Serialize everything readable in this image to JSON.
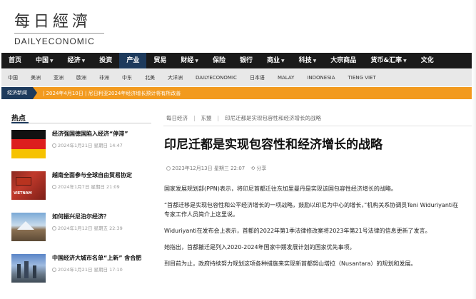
{
  "logo": {
    "zh": "每日經濟",
    "en": "DAILYECONOMIC"
  },
  "main_nav": [
    {
      "label": "首页",
      "caret": false
    },
    {
      "label": "中国",
      "caret": true
    },
    {
      "label": "经济",
      "caret": true
    },
    {
      "label": "投资",
      "caret": false
    },
    {
      "label": "产业",
      "caret": false,
      "active": true
    },
    {
      "label": "贸易",
      "caret": false
    },
    {
      "label": "财经",
      "caret": true
    },
    {
      "label": "保险",
      "caret": false
    },
    {
      "label": "银行",
      "caret": false
    },
    {
      "label": "商业",
      "caret": true
    },
    {
      "label": "科技",
      "caret": true
    },
    {
      "label": "大宗商品",
      "caret": false
    },
    {
      "label": "货币&汇率",
      "caret": true
    },
    {
      "label": "文化",
      "caret": false
    }
  ],
  "sub_nav": [
    "中国",
    "美洲",
    "亚洲",
    "欧洲",
    "非洲",
    "中东",
    "北美",
    "大洋洲",
    "DAILYECONOMIC",
    "日本语",
    "MALAY",
    "INDONESIA",
    "TIENG VIET"
  ],
  "ticker": {
    "label": "经济新闻",
    "text": "| 2024年4月10日 | 尼日利亚2024年经济增长预计将有所改善"
  },
  "sidebar": {
    "title": "热点",
    "items": [
      {
        "headline": "经济强国德国陷入经济“停滞”",
        "date": "2024年1月21日 星期日 14:47"
      },
      {
        "headline": "越南全面参与全球自由贸易协定",
        "date": "2024年1月7日 星期日 21:09"
      },
      {
        "headline": "如何振兴尼泊尔经济？",
        "date": "2024年1月12日 星期五 22:39"
      },
      {
        "headline": "中国经济大城市名单“上新” 含合肥",
        "date": "2024年1月21日 星期日 17:10"
      }
    ]
  },
  "breadcrumb": [
    "每日经济",
    "东盟",
    "印尼迁都是实现包容性和经济增长的战略"
  ],
  "article": {
    "title": "印尼迁都是实现包容性和经济增长的战略",
    "date": "2023年12月13日 星期三 22:07",
    "share": "分享",
    "paragraphs": [
      "国家发展规划部(PPN)表示，将印尼首都迁往东加里曼丹是实现该国包容性经济增长的战略。",
      "“首都迁移是实现包容性和公平经济增长的一项战略，鼓励以印尼为中心的增长，”机构关系协调员Teni Widuriyanti在专家工作人员简介上这里说。",
      "Widuriyanti在发布会上表示，首都的2022年第1季法律修改案将2023年第21号法律的信息更新了发言。",
      "她指出，首都搬迁是列入2020-2024年国家中期发展计划的国家优先事项。",
      "到目前为止，政府持续努力规划这项各种措施来实现新首都努山塔拉（Nusantara）的规划和发展。"
    ]
  }
}
